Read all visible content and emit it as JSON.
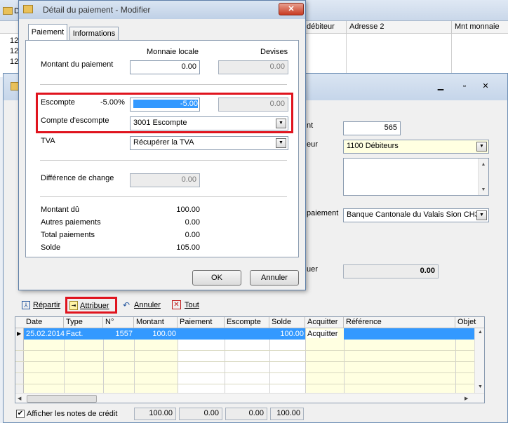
{
  "bg_window": {
    "headers": [
      "débiteur",
      "Adresse 2",
      "Mnt monnaie"
    ],
    "rows": [
      "12",
      "12",
      "12"
    ]
  },
  "fg_window": {
    "labels": {
      "montant_suffix": "nt",
      "debiteur_suffix": "eur",
      "paiement_suffix": "paiement",
      "quer_suffix": "uer"
    },
    "fields": {
      "montant": "565",
      "debiteur": "1100 Débiteurs",
      "banque": "Banque Cantonale du Valais Sion CH3",
      "total": "0.00"
    }
  },
  "toolbar": {
    "repartir": "Répartir",
    "attribuer": "Attribuer",
    "annuler": "Annuler",
    "tout": "Tout"
  },
  "table": {
    "headers": [
      "Date",
      "Type",
      "N°",
      "Montant",
      "Paiement",
      "Escompte",
      "Solde",
      "Acquitter",
      "Référence",
      "Objet"
    ],
    "rows": [
      {
        "date": "25.02.2014",
        "type": "Fact.",
        "num": "1557",
        "montant": "100.00",
        "paiement": "",
        "escompte": "",
        "solde": "100.00",
        "acquitter": "Acquitter",
        "reference": "",
        "objet": ""
      }
    ]
  },
  "footer": {
    "checkbox_label": "Afficher les notes de crédit",
    "checked": true,
    "totals": [
      "100.00",
      "0.00",
      "0.00",
      "100.00"
    ]
  },
  "dialog": {
    "title": "Détail du paiement - Modifier",
    "tabs": [
      "Paiement",
      "Informations"
    ],
    "col_local": "Monnaie locale",
    "col_devises": "Devises",
    "montant_label": "Montant du paiement",
    "montant_local": "0.00",
    "montant_devises": "0.00",
    "escompte_label": "Escompte",
    "escompte_pct": "-5.00%",
    "escompte_local": "-5.00",
    "escompte_devises": "0.00",
    "compte_label": "Compte d'escompte",
    "compte_value": "3001 Escompte",
    "tva_label": "TVA",
    "tva_value": "Récupérer la TVA",
    "diff_label": "Différence de change",
    "diff_value": "0.00",
    "summary": [
      {
        "label": "Montant dû",
        "value": "100.00"
      },
      {
        "label": "Autres paiements",
        "value": "0.00"
      },
      {
        "label": "Total paiements",
        "value": "0.00"
      },
      {
        "label": "Solde",
        "value": "105.00"
      }
    ],
    "ok": "OK",
    "cancel": "Annuler"
  },
  "colors": {
    "highlight": "#e0141e",
    "selected_row": "#3399ff",
    "yellow": "#ffffe1"
  }
}
